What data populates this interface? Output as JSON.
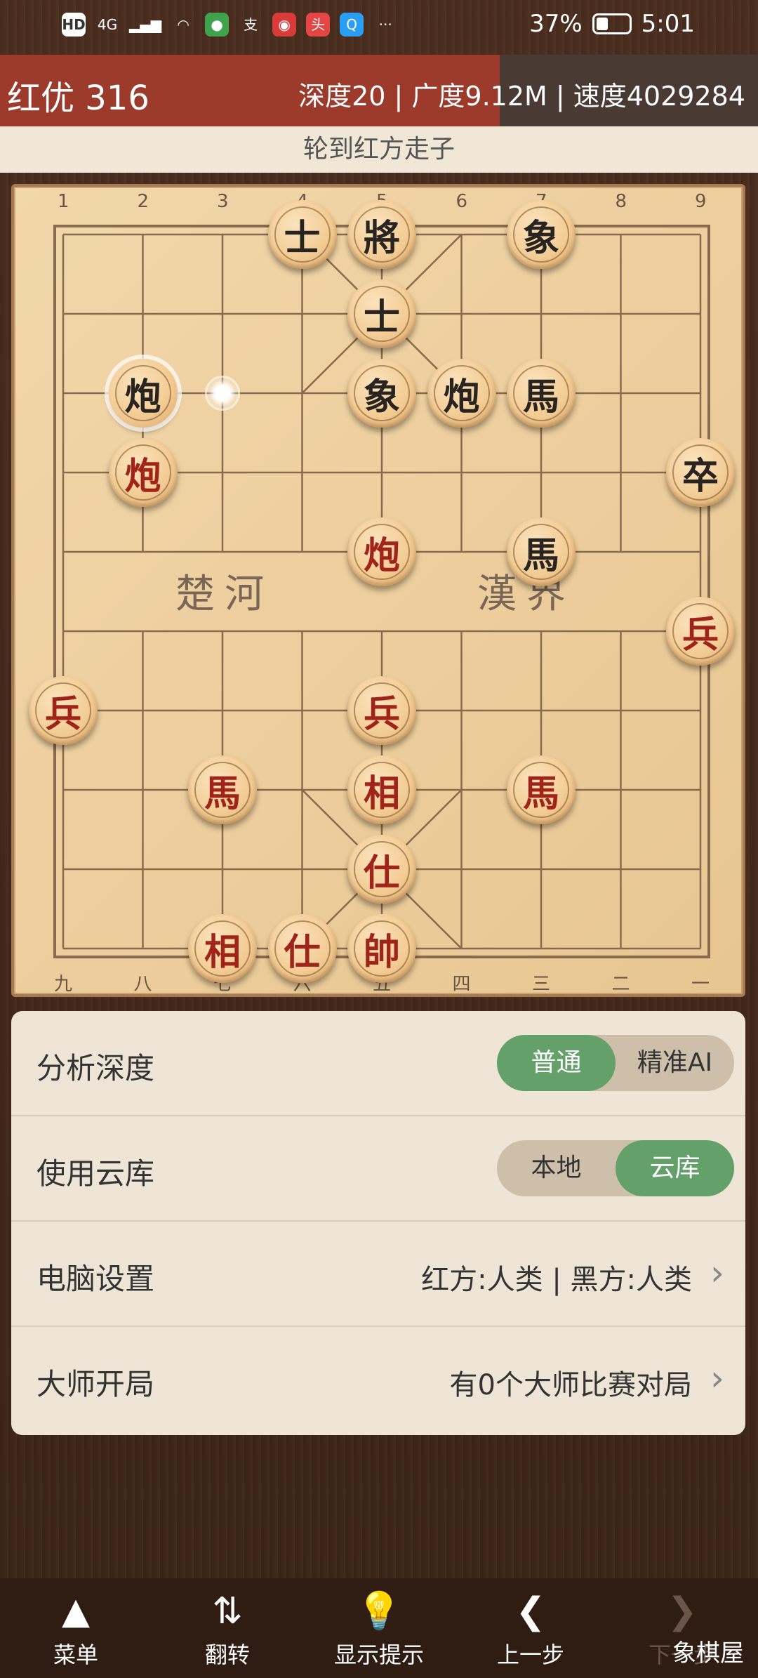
{
  "status_bar": {
    "icons": [
      "HD",
      "4G",
      "signal-icon",
      "wifi-icon",
      "app-icon",
      "alipay-icon",
      "weibo-icon",
      "toutiao-icon",
      "search-app-icon",
      "more-icon"
    ],
    "battery_percent": "37%",
    "battery_level": 0.37,
    "time": "5:01"
  },
  "header": {
    "title": "红优 316",
    "stats": "深度20 | 广度9.12M | 速度4029284"
  },
  "turn_text": "轮到红方走子",
  "board": {
    "top_coords": [
      "1",
      "2",
      "3",
      "4",
      "5",
      "6",
      "7",
      "8",
      "9"
    ],
    "bottom_coords": [
      "九",
      "八",
      "七",
      "六",
      "五",
      "四",
      "三",
      "二",
      "一"
    ],
    "river_left": "楚河",
    "river_right": "漢界",
    "pieces": [
      {
        "char": "士",
        "color": "black",
        "file": 3,
        "rank": 0
      },
      {
        "char": "將",
        "color": "black",
        "file": 4,
        "rank": 0
      },
      {
        "char": "象",
        "color": "black",
        "file": 6,
        "rank": 0
      },
      {
        "char": "士",
        "color": "black",
        "file": 4,
        "rank": 1
      },
      {
        "char": "炮",
        "color": "black",
        "file": 1,
        "rank": 2,
        "selected": true
      },
      {
        "char": "象",
        "color": "black",
        "file": 4,
        "rank": 2
      },
      {
        "char": "炮",
        "color": "black",
        "file": 5,
        "rank": 2
      },
      {
        "char": "馬",
        "color": "black",
        "file": 6,
        "rank": 2
      },
      {
        "char": "炮",
        "color": "red",
        "file": 1,
        "rank": 3
      },
      {
        "char": "卒",
        "color": "black",
        "file": 8,
        "rank": 3
      },
      {
        "char": "炮",
        "color": "red",
        "file": 4,
        "rank": 4
      },
      {
        "char": "馬",
        "color": "black",
        "file": 6,
        "rank": 4
      },
      {
        "char": "兵",
        "color": "red",
        "file": 8,
        "rank": 5
      },
      {
        "char": "兵",
        "color": "red",
        "file": 0,
        "rank": 6
      },
      {
        "char": "兵",
        "color": "red",
        "file": 4,
        "rank": 6
      },
      {
        "char": "馬",
        "color": "red",
        "file": 2,
        "rank": 7
      },
      {
        "char": "相",
        "color": "red",
        "file": 4,
        "rank": 7
      },
      {
        "char": "馬",
        "color": "red",
        "file": 6,
        "rank": 7
      },
      {
        "char": "仕",
        "color": "red",
        "file": 4,
        "rank": 8
      },
      {
        "char": "相",
        "color": "red",
        "file": 2,
        "rank": 9
      },
      {
        "char": "仕",
        "color": "red",
        "file": 3,
        "rank": 9
      },
      {
        "char": "帥",
        "color": "red",
        "file": 4,
        "rank": 9
      }
    ],
    "target_marker": {
      "file": 2,
      "rank": 2
    }
  },
  "settings": [
    {
      "label": "分析深度",
      "type": "segment",
      "options": [
        "普通",
        "精准AI"
      ],
      "active": 0
    },
    {
      "label": "使用云库",
      "type": "segment",
      "options": [
        "本地",
        "云库"
      ],
      "active": 1
    },
    {
      "label": "电脑设置",
      "type": "link",
      "value": "红方:人类 | 黑方:人类"
    },
    {
      "label": "大师开局",
      "type": "link",
      "value": "有0个大师比赛对局"
    }
  ],
  "bottom_nav": [
    {
      "label": "菜单",
      "icon": "menu-icon",
      "glyph": "▲"
    },
    {
      "label": "翻转",
      "icon": "flip-icon",
      "glyph": "⇅"
    },
    {
      "label": "显示提示",
      "icon": "hint-bulb-icon",
      "glyph": "💡"
    },
    {
      "label": "上一步",
      "icon": "back-icon",
      "glyph": "❮"
    },
    {
      "label": "下一步",
      "icon": "forward-icon",
      "glyph": "❯",
      "disabled": true
    }
  ],
  "watermark": "象棋屋"
}
